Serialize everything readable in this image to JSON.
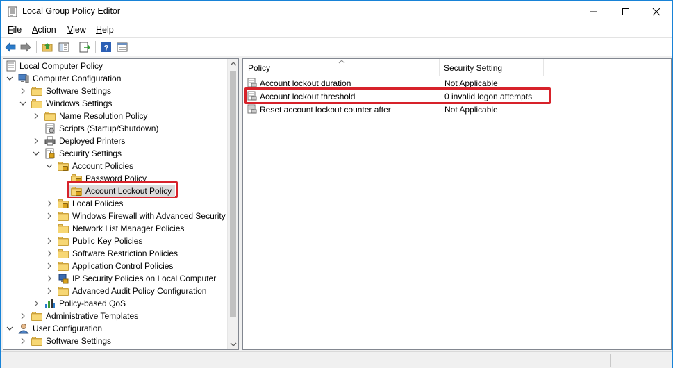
{
  "window": {
    "title": "Local Group Policy Editor",
    "accent_color": "#1883d7"
  },
  "menu": {
    "items": [
      {
        "mnemonic": "F",
        "rest": "ile"
      },
      {
        "mnemonic": "A",
        "rest": "ction"
      },
      {
        "mnemonic": "V",
        "rest": "iew"
      },
      {
        "mnemonic": "H",
        "rest": "elp"
      }
    ]
  },
  "toolbar": {
    "icons": [
      "back-arrow-icon",
      "forward-arrow-icon",
      "up-folder-icon",
      "show-hide-tree-icon",
      "export-list-icon",
      "help-icon",
      "properties-icon"
    ]
  },
  "tree": {
    "items": [
      {
        "label": "Local Computer Policy",
        "icon": "policy-document-icon",
        "expander": "none"
      },
      {
        "label": "Computer Configuration",
        "icon": "computer-icon",
        "expander": "expanded"
      },
      {
        "label": "Software Settings",
        "icon": "folder-icon",
        "expander": "collapsed"
      },
      {
        "label": "Windows Settings",
        "icon": "folder-icon",
        "expander": "expanded"
      },
      {
        "label": "Name Resolution Policy",
        "icon": "folder-icon",
        "expander": "collapsed"
      },
      {
        "label": "Scripts (Startup/Shutdown)",
        "icon": "scripts-icon",
        "expander": "none"
      },
      {
        "label": "Deployed Printers",
        "icon": "printer-icon",
        "expander": "collapsed"
      },
      {
        "label": "Security Settings",
        "icon": "security-settings-icon",
        "expander": "expanded"
      },
      {
        "label": "Account Policies",
        "icon": "locked-folder-icon",
        "expander": "expanded"
      },
      {
        "label": "Password Policy",
        "icon": "locked-folder-icon",
        "expander": "none"
      },
      {
        "label": "Account Lockout Policy",
        "icon": "locked-folder-icon",
        "expander": "none",
        "selected": true
      },
      {
        "label": "Local Policies",
        "icon": "locked-folder-icon",
        "expander": "collapsed"
      },
      {
        "label": "Windows Firewall with Advanced Security",
        "icon": "folder-icon",
        "expander": "collapsed"
      },
      {
        "label": "Network List Manager Policies",
        "icon": "folder-icon",
        "expander": "none"
      },
      {
        "label": "Public Key Policies",
        "icon": "folder-icon",
        "expander": "collapsed"
      },
      {
        "label": "Software Restriction Policies",
        "icon": "folder-icon",
        "expander": "collapsed"
      },
      {
        "label": "Application Control Policies",
        "icon": "folder-icon",
        "expander": "collapsed"
      },
      {
        "label": "IP Security Policies on Local Computer",
        "icon": "ip-security-icon",
        "expander": "collapsed"
      },
      {
        "label": "Advanced Audit Policy Configuration",
        "icon": "folder-icon",
        "expander": "collapsed"
      },
      {
        "label": "Policy-based QoS",
        "icon": "qos-chart-icon",
        "expander": "collapsed"
      },
      {
        "label": "Administrative Templates",
        "icon": "folder-icon",
        "expander": "collapsed"
      },
      {
        "label": "User Configuration",
        "icon": "user-icon",
        "expander": "expanded"
      },
      {
        "label": "Software Settings",
        "icon": "folder-icon",
        "expander": "collapsed"
      }
    ]
  },
  "list": {
    "headers": {
      "policy": "Policy",
      "setting": "Security Setting"
    },
    "rows": [
      {
        "policy": "Account lockout duration",
        "setting": "Not Applicable"
      },
      {
        "policy": "Account lockout threshold",
        "setting": "0 invalid logon attempts",
        "highlighted": true
      },
      {
        "policy": "Reset account lockout counter after",
        "setting": "Not Applicable"
      }
    ]
  },
  "highlight_color": "#d7222a"
}
